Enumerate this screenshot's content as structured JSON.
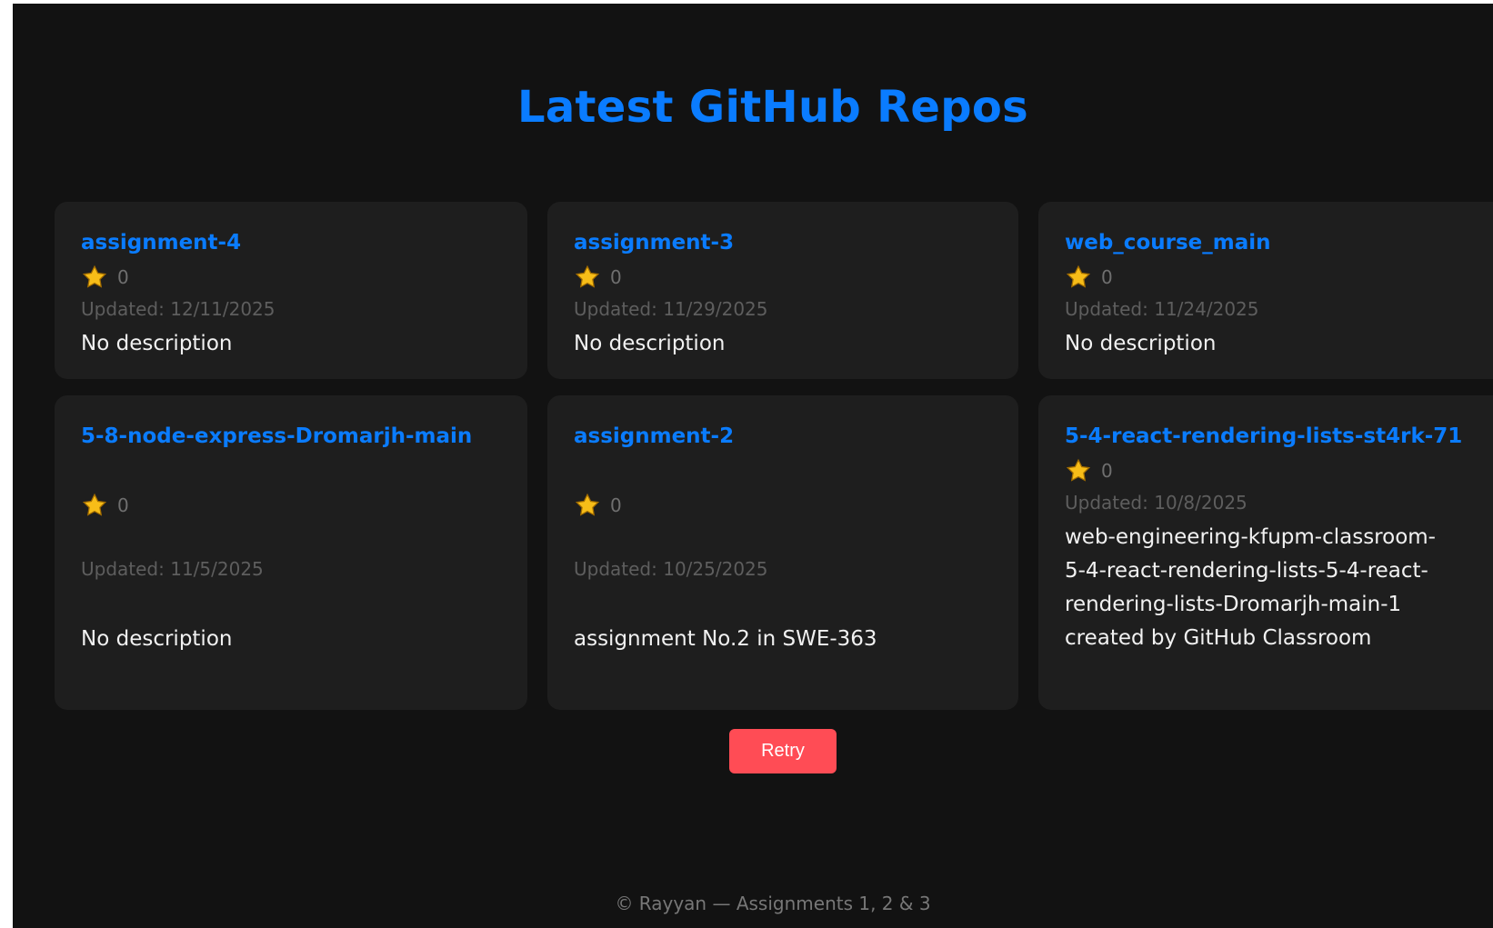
{
  "header": {
    "title": "Latest GitHub Repos"
  },
  "repos": [
    {
      "name": "assignment-4",
      "stars": "0",
      "updated": "Updated: 12/11/2025",
      "description": "No description"
    },
    {
      "name": "assignment-3",
      "stars": "0",
      "updated": "Updated: 11/29/2025",
      "description": "No description"
    },
    {
      "name": "web_course_main",
      "stars": "0",
      "updated": "Updated: 11/24/2025",
      "description": "No description"
    },
    {
      "name": "5-8-node-express-Dromarjh-main",
      "stars": "0",
      "updated": "Updated: 11/5/2025",
      "description": "No description"
    },
    {
      "name": "assignment-2",
      "stars": "0",
      "updated": "Updated: 10/25/2025",
      "description": "assignment No.2 in SWE-363"
    },
    {
      "name": "5-4-react-rendering-lists-st4rk-71",
      "stars": "0",
      "updated": "Updated: 10/8/2025",
      "description": "web-engineering-kfupm-classroom-5-4-react-rendering-lists-5-4-react-rendering-lists-Dromarjh-main-1 created by GitHub Classroom"
    }
  ],
  "actions": {
    "retry_label": "Retry"
  },
  "footer": {
    "text": "© Rayyan — Assignments 1, 2 & 3"
  },
  "icons": {
    "star": "star-icon"
  },
  "colors": {
    "background": "#121212",
    "card": "#1e1e1e",
    "accent": "#0a7cff",
    "retry": "#ff4c55",
    "star": "#f7bd18"
  }
}
